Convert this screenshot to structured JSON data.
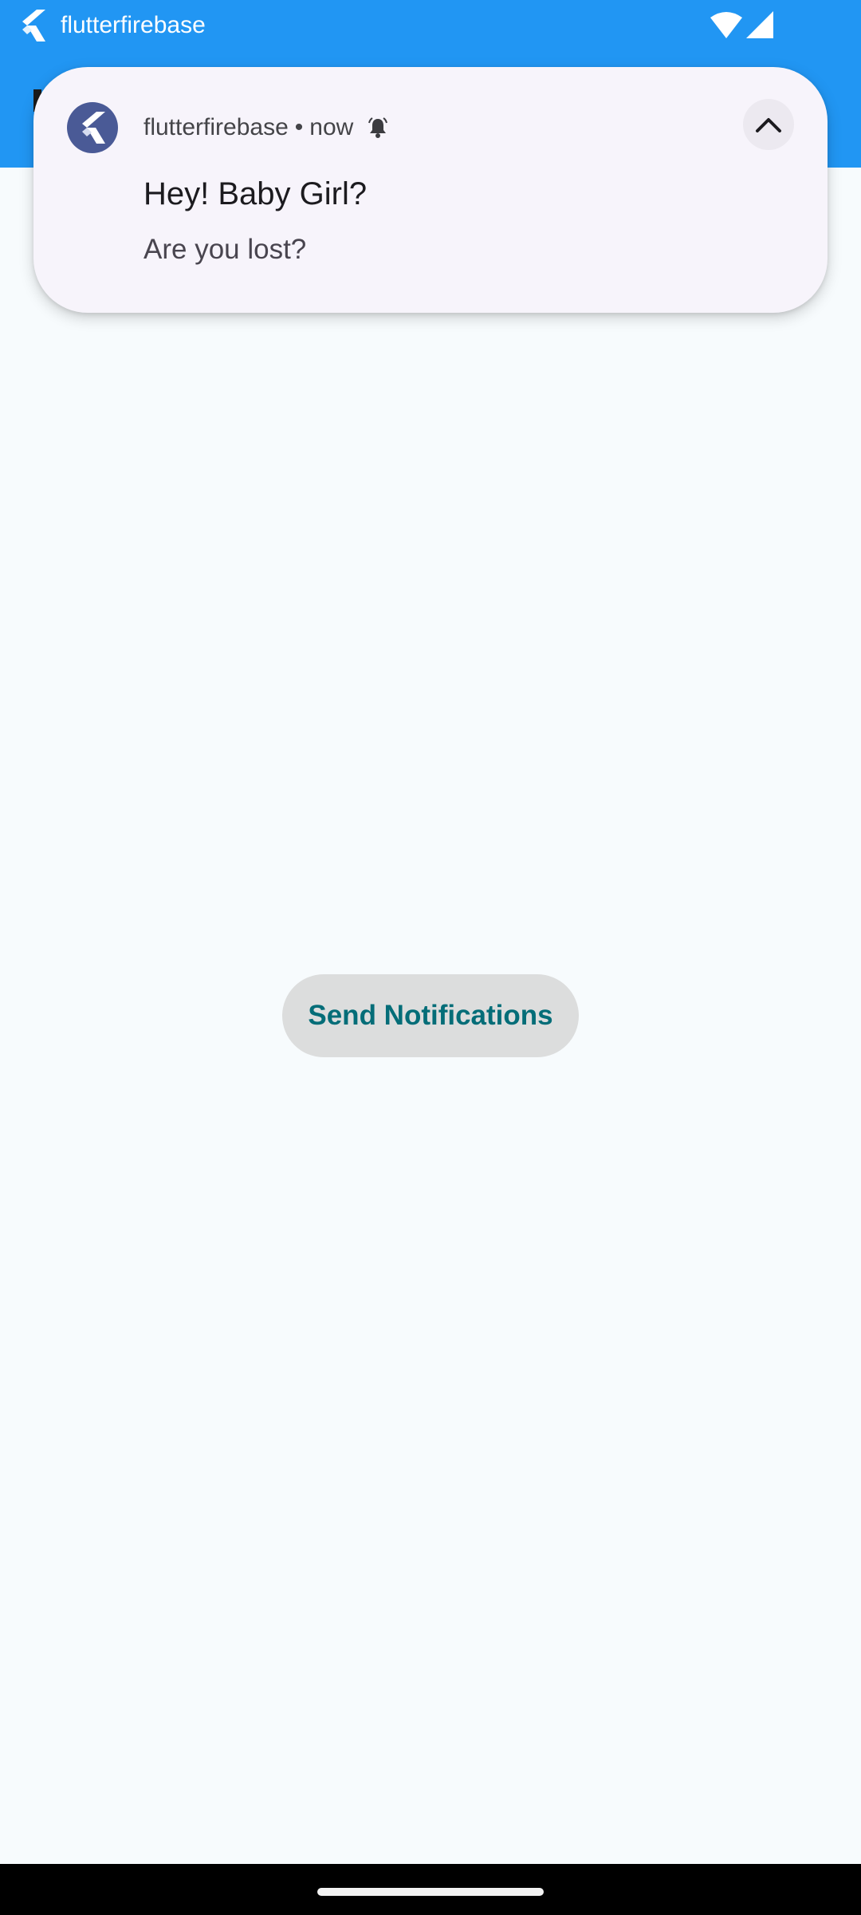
{
  "status_bar": {
    "app_name": "flutterfirebase",
    "icons": [
      "flutter-icon",
      "wifi-icon",
      "signal-icon"
    ]
  },
  "notification": {
    "app_name": "flutterfirebase",
    "separator": "•",
    "time": "now",
    "title": "Hey! Baby Girl?",
    "body": "Are you lost?",
    "icons": [
      "flutter-icon",
      "bell-icon",
      "chevron-up-icon"
    ]
  },
  "main": {
    "button_label": "Send Notifications"
  },
  "colors": {
    "appbar": "#2196f3",
    "background": "#f7fbfd",
    "button_bg": "#dcdddd",
    "button_text": "#046d78",
    "notification_bg": "#f7f4fb",
    "avatar": "#4a5a96"
  }
}
